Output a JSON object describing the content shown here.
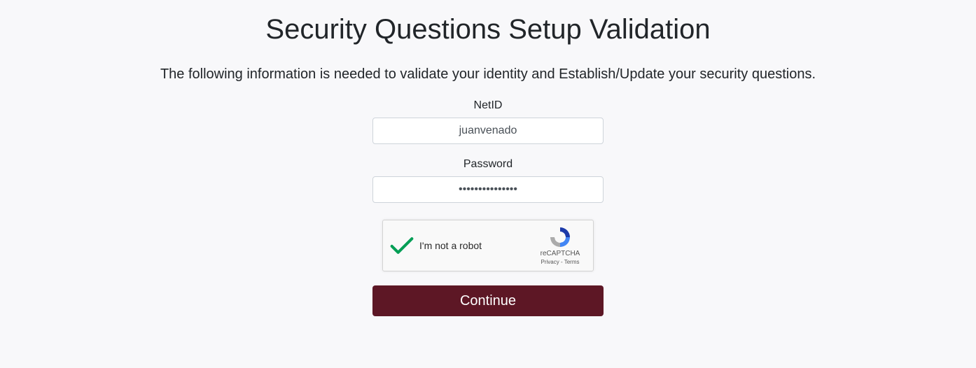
{
  "header": {
    "title": "Security Questions Setup Validation",
    "instruction": "The following information is needed to validate your identity and Establish/Update your security questions."
  },
  "form": {
    "netid": {
      "label": "NetID",
      "value": "juanvenado"
    },
    "password": {
      "label": "Password",
      "value": "•••••••••••••••"
    },
    "recaptcha": {
      "label": "I'm not a robot",
      "brand": "reCAPTCHA",
      "privacy": "Privacy",
      "terms": "Terms",
      "separator": " - "
    },
    "continue_label": "Continue"
  },
  "colors": {
    "primary_button": "#5d1725",
    "background": "#f8f8fa",
    "check_green": "#009e55"
  }
}
